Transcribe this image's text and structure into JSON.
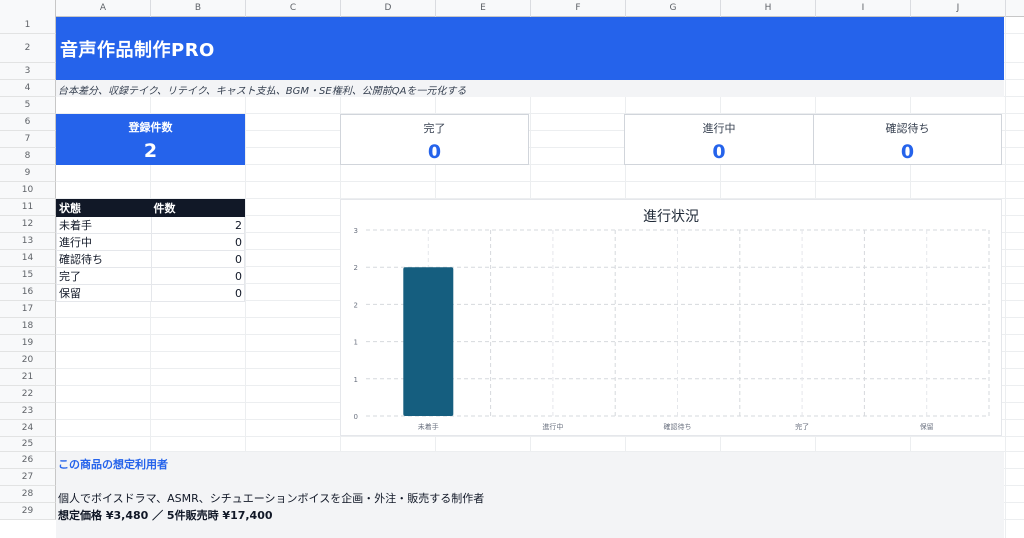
{
  "columns": [
    "A",
    "B",
    "C",
    "D",
    "E",
    "F",
    "G",
    "H",
    "I",
    "J"
  ],
  "rows": [
    "1",
    "2",
    "3",
    "4",
    "5",
    "6",
    "7",
    "8",
    "9",
    "10",
    "11",
    "12",
    "13",
    "14",
    "15",
    "16",
    "17",
    "18",
    "19",
    "20",
    "21",
    "22",
    "23",
    "24",
    "25",
    "26",
    "27",
    "28",
    "29"
  ],
  "header": {
    "title": "音声作品制作PRO",
    "subtitle": "台本差分、収録テイク、リテイク、キャスト支払、BGM・SE権利、公開前QAを一元化する"
  },
  "kpis": {
    "registered": {
      "label": "登録件数",
      "value": "2"
    },
    "done": {
      "label": "完了",
      "value": "0"
    },
    "in_progress": {
      "label": "進行中",
      "value": "0"
    },
    "awaiting": {
      "label": "確認待ち",
      "value": "0"
    }
  },
  "status_table": {
    "headers": [
      "状態",
      "件数"
    ],
    "rows": [
      {
        "status": "未着手",
        "count": "2"
      },
      {
        "status": "進行中",
        "count": "0"
      },
      {
        "status": "確認待ち",
        "count": "0"
      },
      {
        "status": "完了",
        "count": "0"
      },
      {
        "status": "保留",
        "count": "0"
      }
    ]
  },
  "chart_data": {
    "type": "bar",
    "title": "進行状況",
    "categories": [
      "未着手",
      "進行中",
      "確認待ち",
      "完了",
      "保留"
    ],
    "values": [
      2,
      0,
      0,
      0,
      0
    ],
    "y_tick_labels": [
      "0",
      "1",
      "1",
      "2",
      "2",
      "3"
    ],
    "ylim": [
      0,
      2.5
    ],
    "grid": true,
    "bar_color": "#155e7f"
  },
  "target_users": {
    "title": "この商品の想定利用者",
    "description": "個人でボイスドラマ、ASMR、シチュエーションボイスを企画・外注・販売する制作者",
    "price": "想定価格 ¥3,480 ／ 5件販売時 ¥17,400"
  },
  "colors": {
    "accent": "#2563eb",
    "table_header": "#111827",
    "bar": "#155e7f"
  }
}
